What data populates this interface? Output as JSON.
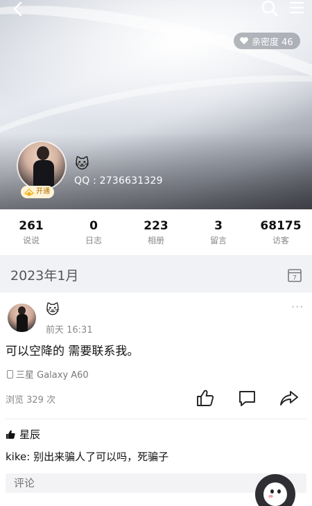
{
  "header": {
    "back_icon": "back-arrow-icon",
    "search_icon": "search-icon",
    "menu_icon": "menu-icon",
    "intimacy_label": "亲密度 46"
  },
  "profile": {
    "name_emoji": "🐱",
    "qq": "QQ : 2736631329",
    "badge_label": "开通"
  },
  "stats": [
    {
      "value": "261",
      "label": "说说"
    },
    {
      "value": "0",
      "label": "日志"
    },
    {
      "value": "223",
      "label": "相册"
    },
    {
      "value": "3",
      "label": "留言"
    },
    {
      "value": "68175",
      "label": "访客"
    }
  ],
  "month": {
    "title": "2023年1月",
    "calendar_day": "7"
  },
  "post": {
    "name_emoji": "🐱",
    "time": "前天 16:31",
    "more": "···",
    "text": "可以空降的 需要联系我。",
    "device": "三星 Galaxy A60",
    "views": "浏览 329 次"
  },
  "likes": {
    "user": "星辰"
  },
  "comment": {
    "user": "kike:",
    "text": " 别出来骗人了可以吗，死骗子"
  },
  "comment_box": {
    "placeholder": "评论"
  }
}
